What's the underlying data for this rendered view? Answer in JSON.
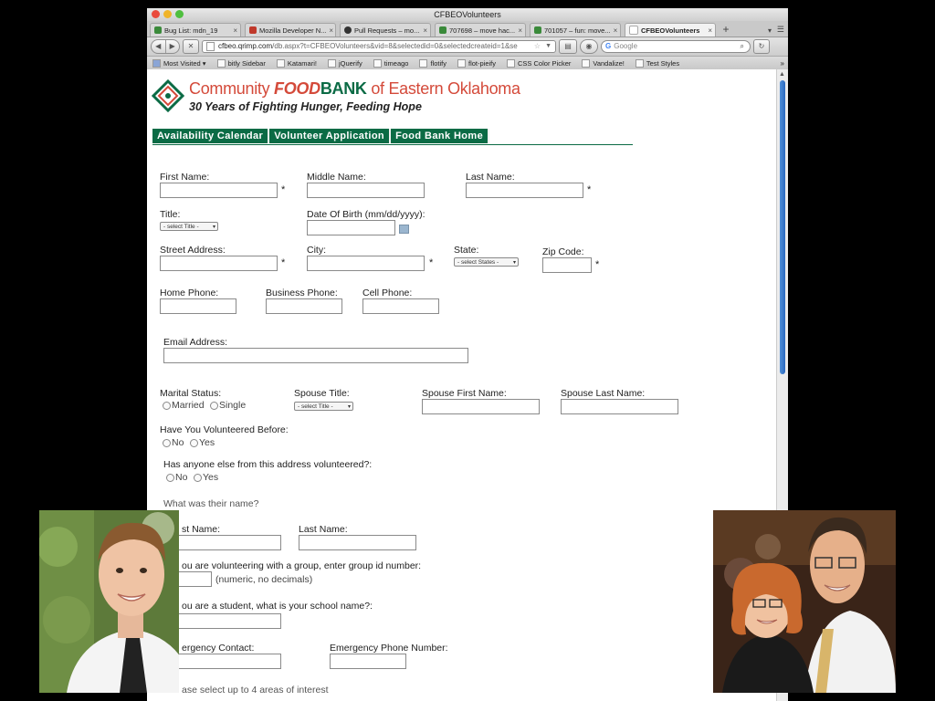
{
  "window": {
    "title": "CFBEOVolunteers"
  },
  "tabs": [
    {
      "label": "Bug List: mdn_19",
      "color": "#3a8a3a"
    },
    {
      "label": "Mozilla Developer N...",
      "color": "#c0392b"
    },
    {
      "label": "Pull Requests – mo...",
      "color": "#333333"
    },
    {
      "label": "707698 – move hac...",
      "color": "#3a8a3a"
    },
    {
      "label": "701057 – fun: move...",
      "color": "#3a8a3a"
    },
    {
      "label": "CFBEOVolunteers",
      "color": "#cccccc"
    }
  ],
  "tab_plus": "+",
  "nav": {
    "back": "◀",
    "forward": "▶",
    "stop": "✕",
    "url_host": "cfbeo.qrimp.com",
    "url_path": "/db.aspx?t=CFBEOVolunteers&vid=8&selectedid=0&selectedcreateid=1&se",
    "search_placeholder": "Google",
    "reload": "↻"
  },
  "bookmarks": [
    "Most Visited ▾",
    "bitly Sidebar",
    "Katamari!",
    "jQuerify",
    "timeago",
    "flotify",
    "flot-pieify",
    "CSS Color Picker",
    "Vandalize!",
    "Test Styles"
  ],
  "bookmarks_more": "»",
  "org": {
    "part1": "Community ",
    "part2": "FOOD",
    "part3": "BANK",
    "part4": " of Eastern Oklahoma",
    "tagline": "30 Years of Fighting Hunger, Feeding Hope"
  },
  "menu": [
    "Availability Calendar",
    "Volunteer Application",
    "Food Bank Home"
  ],
  "form": {
    "first_name": "First Name:",
    "middle_name": "Middle Name:",
    "last_name": "Last Name:",
    "title": "Title:",
    "title_select": "- select Title -",
    "dob": "Date Of Birth (mm/dd/yyyy):",
    "street": "Street Address:",
    "city": "City:",
    "state": "State:",
    "state_select": "- select States -",
    "zip": "Zip Code:",
    "home_phone": "Home Phone:",
    "business_phone": "Business Phone:",
    "cell_phone": "Cell Phone:",
    "email": "Email Address:",
    "marital": "Marital Status:",
    "married": "Married",
    "single": "Single",
    "spouse_title": "Spouse Title:",
    "spouse_select": "- select Title -",
    "spouse_first": "Spouse First Name:",
    "spouse_last": "Spouse Last Name:",
    "volunteered_before": "Have You Volunteered Before:",
    "no": "No",
    "yes": "Yes",
    "anyone_else": "Has anyone else from this address volunteered?:",
    "their_name": "What was their name?",
    "their_first": "st Name:",
    "their_last": "Last Name:",
    "group": "ou are volunteering with a group, enter group id number:",
    "group_hint": "(numeric, no decimals)",
    "student": "ou are a student, what is your school name?:",
    "emergency_contact": "ergency Contact:",
    "emergency_phone": "Emergency Phone Number:",
    "interests": "ase select up to 4 areas of interest",
    "required_mark": "*"
  }
}
